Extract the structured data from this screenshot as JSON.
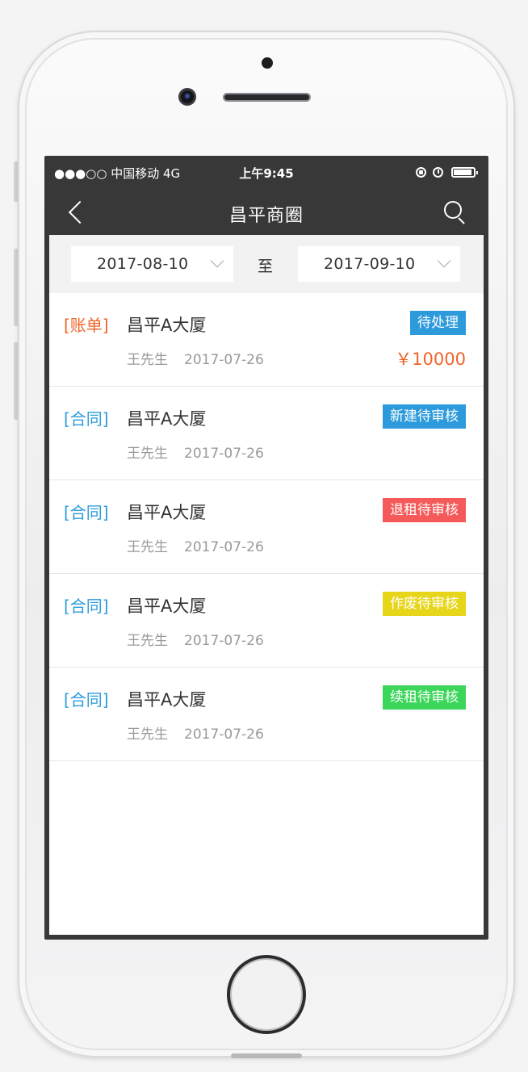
{
  "status_bar": {
    "carrier": "●●●○○ 中国移动   4G",
    "time": "上午9:45"
  },
  "nav": {
    "title": "昌平商圈"
  },
  "filter": {
    "start_date": "2017-08-10",
    "separator": "至",
    "end_date": "2017-09-10"
  },
  "records": [
    {
      "tag": "[账单]",
      "tag_color": "#f0642a",
      "title": "昌平A大厦",
      "person": "王先生",
      "date": "2017-07-26",
      "status": "待处理",
      "status_color": "#2d9bdb",
      "amount": "￥10000"
    },
    {
      "tag": "[合同]",
      "tag_color": "#2d9bdb",
      "title": "昌平A大厦",
      "person": "王先生",
      "date": "2017-07-26",
      "status": "新建待审核",
      "status_color": "#2d9bdb"
    },
    {
      "tag": "[合同]",
      "tag_color": "#2d9bdb",
      "title": "昌平A大厦",
      "person": "王先生",
      "date": "2017-07-26",
      "status": "退租待审核",
      "status_color": "#f45a5a"
    },
    {
      "tag": "[合同]",
      "tag_color": "#2d9bdb",
      "title": "昌平A大厦",
      "person": "王先生",
      "date": "2017-07-26",
      "status": "作废待审核",
      "status_color": "#e7d51a"
    },
    {
      "tag": "[合同]",
      "tag_color": "#2d9bdb",
      "title": "昌平A大厦",
      "person": "王先生",
      "date": "2017-07-26",
      "status": "续租待审核",
      "status_color": "#3cd65a"
    }
  ]
}
